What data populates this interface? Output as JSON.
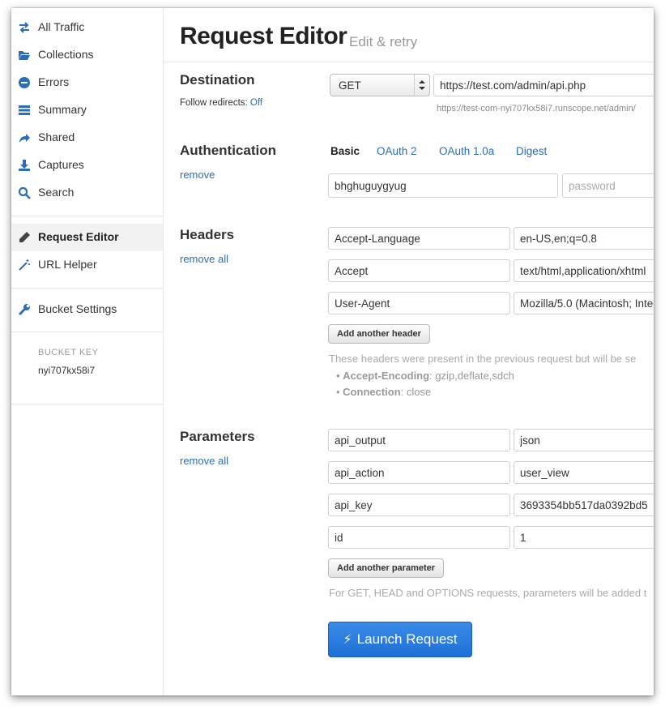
{
  "sidebar": {
    "items": [
      {
        "label": "All Traffic",
        "icon": "arrows-icon"
      },
      {
        "label": "Collections",
        "icon": "folder-icon"
      },
      {
        "label": "Errors",
        "icon": "minus-circle-icon"
      },
      {
        "label": "Summary",
        "icon": "list-icon"
      },
      {
        "label": "Shared",
        "icon": "share-icon"
      },
      {
        "label": "Captures",
        "icon": "download-icon"
      },
      {
        "label": "Search",
        "icon": "search-icon"
      },
      {
        "label": "Request Editor",
        "icon": "pencil-icon",
        "active": true
      },
      {
        "label": "URL Helper",
        "icon": "magic-wand-icon"
      },
      {
        "label": "Bucket Settings",
        "icon": "wrench-icon"
      }
    ],
    "bucket_key_title": "BUCKET KEY",
    "bucket_key": "nyi707kx58i7"
  },
  "header": {
    "title": "Request Editor",
    "subtitle": "Edit & retry"
  },
  "destination": {
    "title": "Destination",
    "follow_label": "Follow redirects:",
    "follow_value": "Off",
    "method": "GET",
    "url": "https://test.com/admin/api.php",
    "proxy_url": "https://test-com-nyi707kx58i7.runscope.net/admin/"
  },
  "authentication": {
    "title": "Authentication",
    "remove": "remove",
    "tabs": [
      "Basic",
      "OAuth 2",
      "OAuth 1.0a",
      "Digest"
    ],
    "active_tab": "Basic",
    "username": "bhghuguygyug",
    "password_placeholder": "password"
  },
  "headers": {
    "title": "Headers",
    "remove_all": "remove all",
    "rows": [
      {
        "name": "Accept-Language",
        "value": "en-US,en;q=0.8"
      },
      {
        "name": "Accept",
        "value": "text/html,application/xhtml"
      },
      {
        "name": "User-Agent",
        "value": "Mozilla/5.0 (Macintosh; Inte"
      }
    ],
    "add_button": "Add another header",
    "note": "These headers were present in the previous request but will be se",
    "excluded": [
      {
        "name": "Accept-Encoding",
        "value": "gzip,deflate,sdch"
      },
      {
        "name": "Connection",
        "value": "close"
      }
    ]
  },
  "parameters": {
    "title": "Parameters",
    "remove_all": "remove all",
    "rows": [
      {
        "name": "api_output",
        "value": "json"
      },
      {
        "name": "api_action",
        "value": "user_view"
      },
      {
        "name": "api_key",
        "value": "3693354bb517da0392bd5"
      },
      {
        "name": "id",
        "value": "1"
      }
    ],
    "add_button": "Add another parameter",
    "note": "For GET, HEAD and OPTIONS requests, parameters will be added t"
  },
  "launch_button": "Launch Request",
  "colors": {
    "link": "#2a6ebb",
    "primary": "#1e6fd6"
  }
}
